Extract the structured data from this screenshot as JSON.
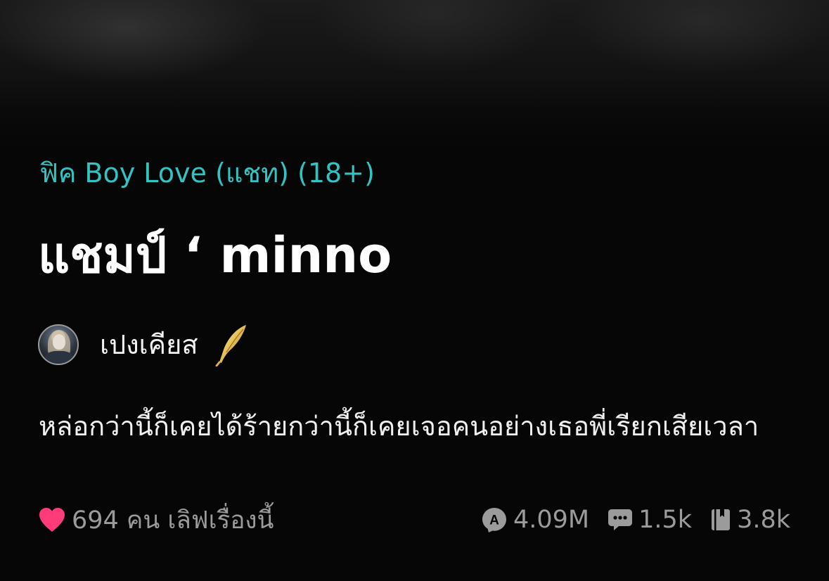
{
  "story": {
    "category": "ฟิค Boy Love (แชท) (18+)",
    "title": "แชมป์ ‘ minno",
    "description": "หล่อกว่านี้ก็เคยได้ร้ายกว่านี้ก็เคยเจอคนอย่างเธอพี่เรียกเสียเวลา"
  },
  "author": {
    "name": "เปงเคียส",
    "avatar_icon": "user-avatar",
    "badge_icon": "golden-quill-icon"
  },
  "stats": {
    "love_text": "694 คน เลิฟเรื่องนี้",
    "views": "4.09M",
    "comments": "1.5k",
    "chapters": "3.8k"
  },
  "colors": {
    "category": "#33c3c0",
    "heart": "#ff3b7a",
    "stats_text": "#9b9b9b",
    "background": "#060606"
  }
}
